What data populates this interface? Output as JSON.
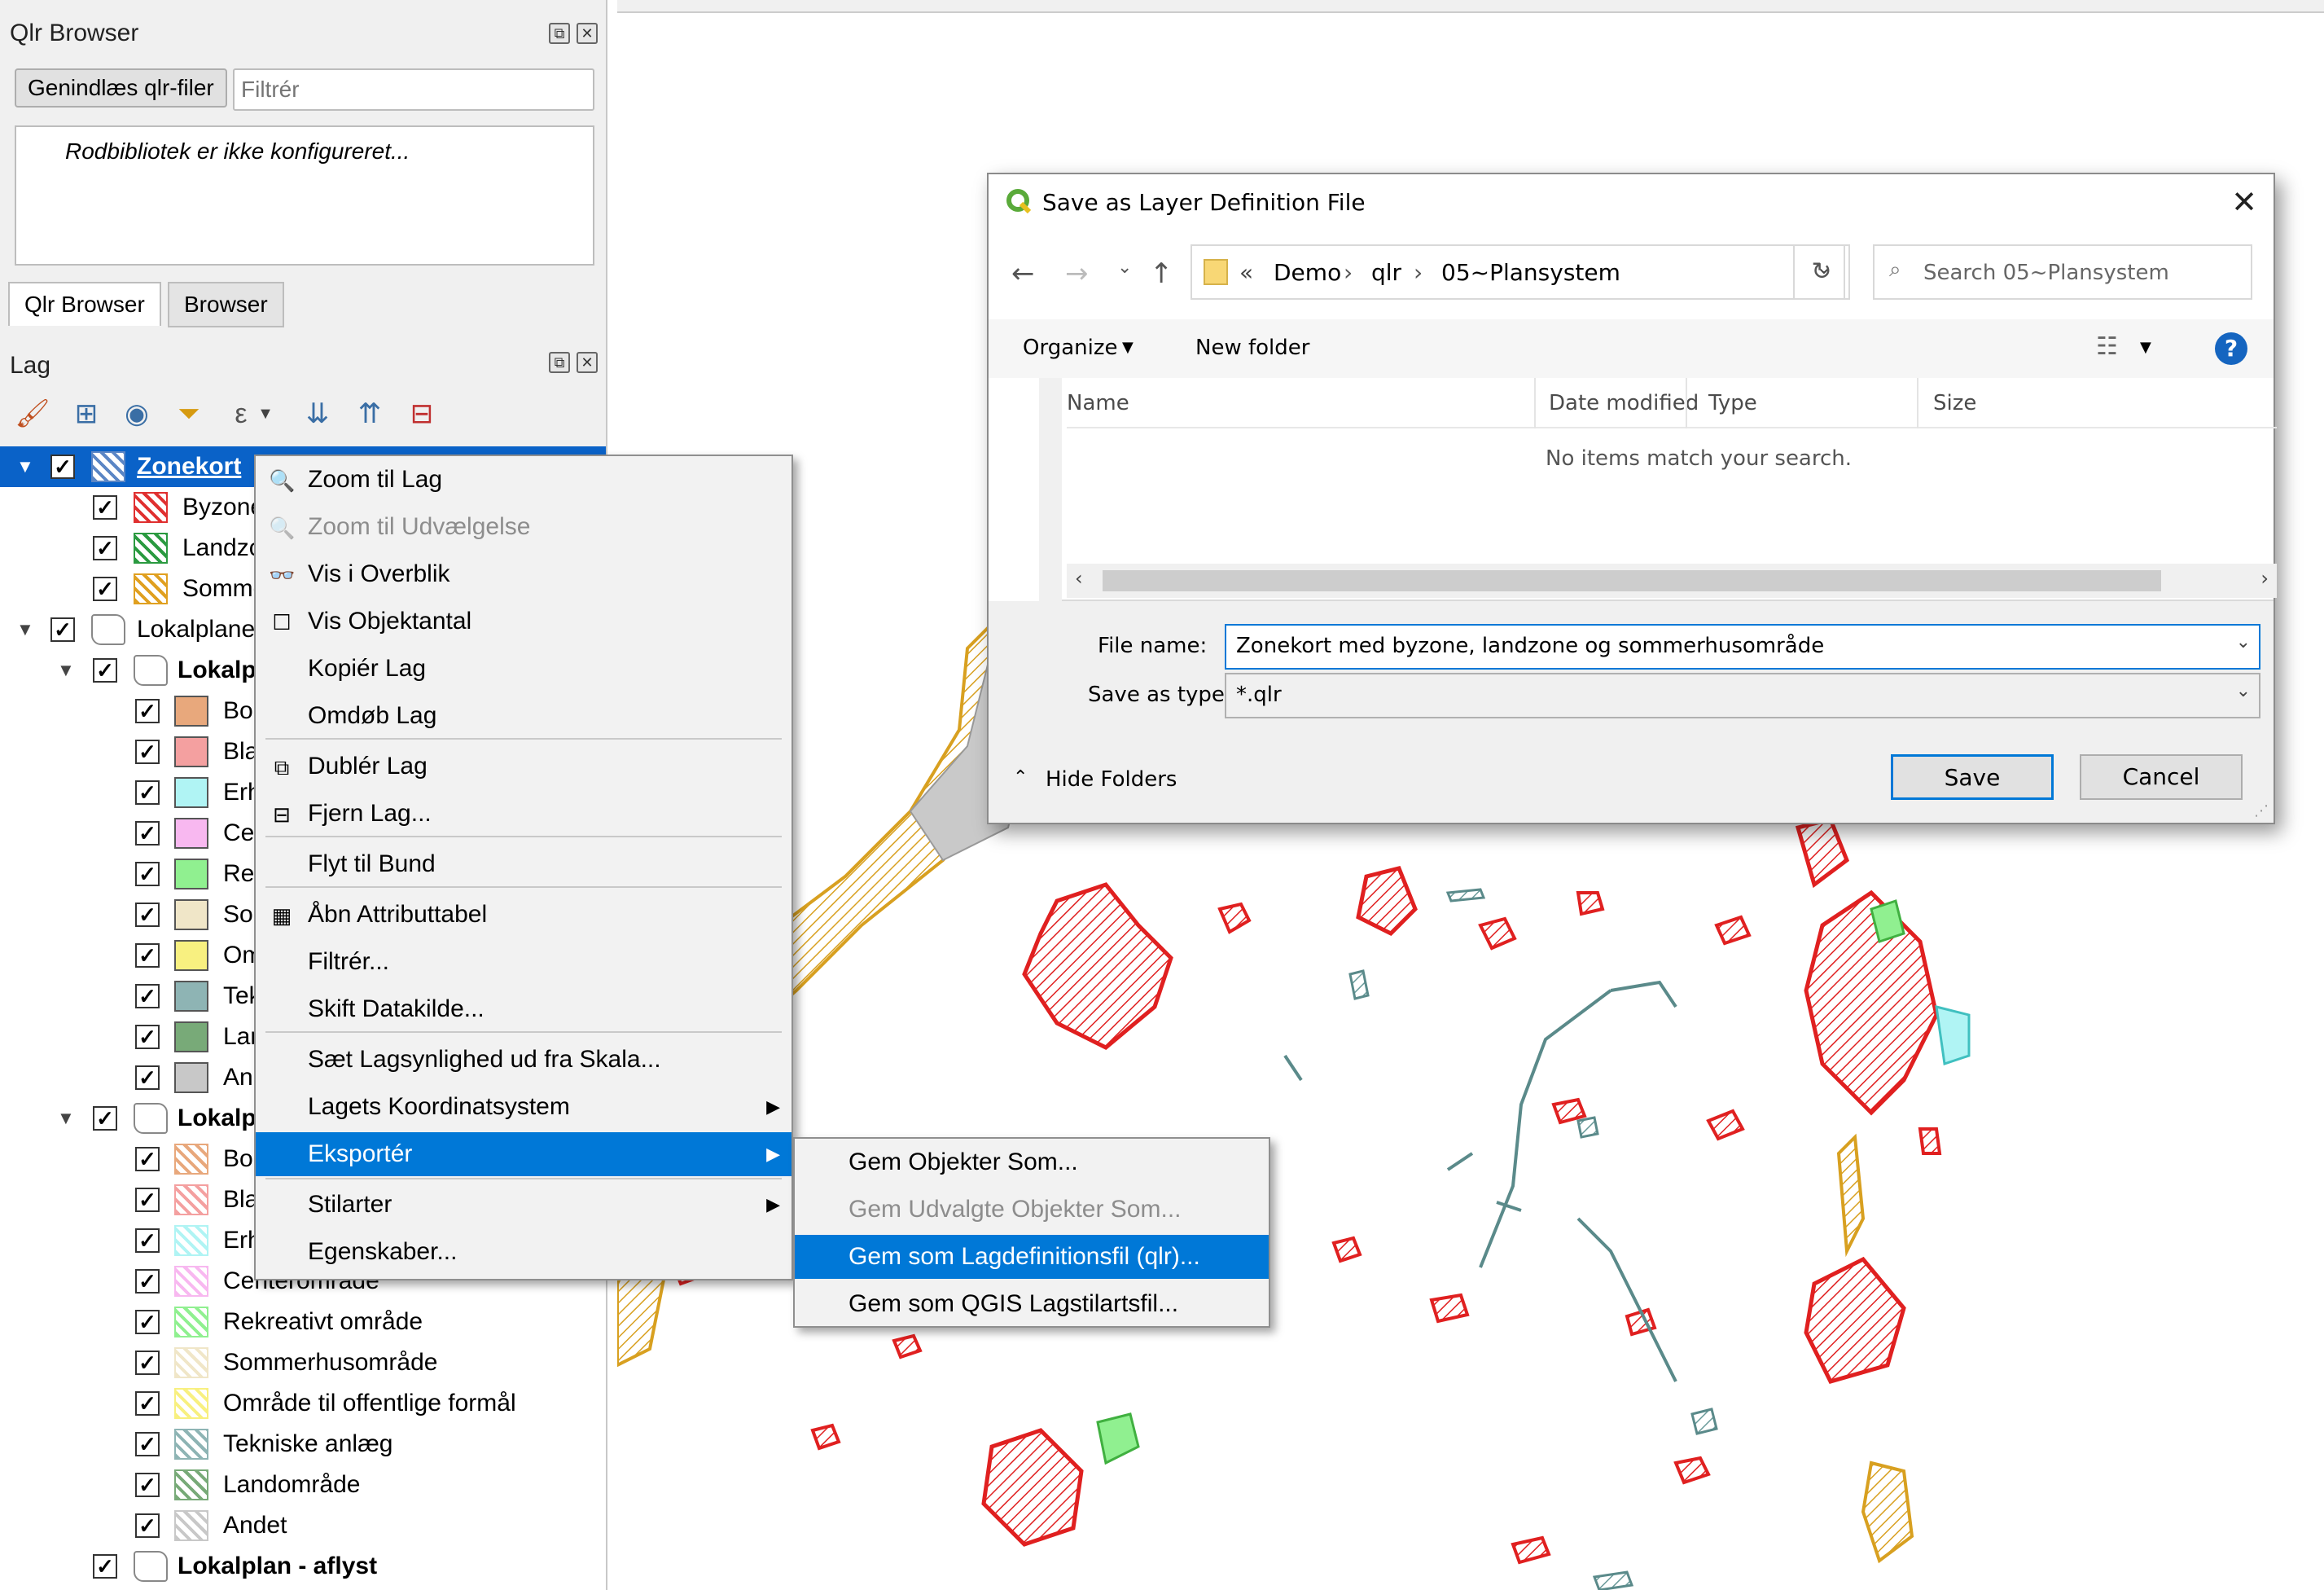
{
  "qlr_panel": {
    "title": "Qlr Browser",
    "reload_button": "Genindlæs qlr-filer",
    "filter_placeholder": "Filtrér",
    "root_message": "Rodbibliotek er ikke konfigureret...",
    "tabs": [
      "Qlr Browser",
      "Browser"
    ]
  },
  "layers_panel": {
    "title": "Lag",
    "tree": [
      {
        "label": "Zonekort",
        "checked": true,
        "expanded": true,
        "selected": true,
        "bold": false,
        "color": "#5b86c5"
      },
      {
        "label": "Byzone",
        "checked": true,
        "color": "#e03030"
      },
      {
        "label": "Landzone",
        "checked": true,
        "color": "#2a9a40"
      },
      {
        "label": "Sommerhusområde",
        "checked": true,
        "color": "#e0a020"
      },
      {
        "label": "Lokalplaner",
        "checked": true,
        "expanded": true
      },
      {
        "label": "Lokalplan - vedtaget",
        "checked": true,
        "expanded": true,
        "bold": true
      },
      {
        "label": "Boligområde",
        "checked": true,
        "color": "#e8a87c"
      },
      {
        "label": "Blandet bolig og erhverv",
        "checked": true,
        "color": "#f4a0a0"
      },
      {
        "label": "Erhvervsområde",
        "checked": true,
        "color": "#b0f4f4"
      },
      {
        "label": "Centerområde",
        "checked": true,
        "color": "#f8b8f0"
      },
      {
        "label": "Rekreativt område",
        "checked": true,
        "color": "#90f090"
      },
      {
        "label": "Sommerhusområde",
        "checked": true,
        "color": "#f0e6c8"
      },
      {
        "label": "Område til offentlige formål",
        "checked": true,
        "color": "#f8f080"
      },
      {
        "label": "Tekniske anlæg",
        "checked": true,
        "color": "#8eb4b4"
      },
      {
        "label": "Landområde",
        "checked": true,
        "color": "#78aa78"
      },
      {
        "label": "Andet",
        "checked": true,
        "color": "#c8c8c8"
      },
      {
        "label": "Lokalplan - forslag",
        "checked": true,
        "expanded": true,
        "bold": true
      },
      {
        "label": "Boligområde",
        "checked": true,
        "color": "#e8a87c"
      },
      {
        "label": "Blandet bolig og erhverv",
        "checked": true,
        "color": "#f4a0a0"
      },
      {
        "label": "Erhvervsområde",
        "checked": true,
        "color": "#b0f4f4"
      },
      {
        "label": "Centerområde",
        "checked": true,
        "color": "#f8b8f0"
      },
      {
        "label": "Rekreativt område",
        "checked": true,
        "color": "#90f090"
      },
      {
        "label": "Sommerhusområde",
        "checked": true,
        "color": "#f0e6c8"
      },
      {
        "label": "Område til offentlige formål",
        "checked": true,
        "color": "#f8f080"
      },
      {
        "label": "Tekniske anlæg",
        "checked": true,
        "color": "#8eb4b4"
      },
      {
        "label": "Landområde",
        "checked": true,
        "color": "#78aa78"
      },
      {
        "label": "Andet",
        "checked": true,
        "color": "#c8c8c8"
      },
      {
        "label": "Lokalplan - aflyst",
        "checked": true,
        "bold": true
      }
    ]
  },
  "context_menu": {
    "items": [
      {
        "label": "Zoom til Lag",
        "icon": "magnifier-icon",
        "glyph": "🔍"
      },
      {
        "label": "Zoom til Udvælgelse",
        "icon": "magnifier-icon",
        "glyph": "🔍",
        "disabled": true
      },
      {
        "label": "Vis i Overblik",
        "icon": "glasses-icon",
        "glyph": "👓"
      },
      {
        "label": "Vis Objektantal",
        "icon": "checkbox-icon",
        "glyph": "☐"
      },
      {
        "label": "Kopiér Lag"
      },
      {
        "label": "Omdøb Lag"
      },
      {
        "label": "Dublér Lag",
        "icon": "duplicate-icon",
        "glyph": "⧉"
      },
      {
        "label": "Fjern Lag...",
        "icon": "remove-layer-icon",
        "glyph": "⊟"
      },
      {
        "label": "Flyt til Bund"
      },
      {
        "label": "Åbn Attributtabel",
        "icon": "table-icon",
        "glyph": "▦"
      },
      {
        "label": "Filtrér..."
      },
      {
        "label": "Skift Datakilde..."
      },
      {
        "label": "Sæt Lagsynlighed ud fra Skala..."
      },
      {
        "label": "Lagets Koordinatsystem",
        "submenu": true
      },
      {
        "label": "Eksportér",
        "submenu": true,
        "active": true
      },
      {
        "label": "Stilarter",
        "submenu": true
      },
      {
        "label": "Egenskaber..."
      }
    ],
    "submenu_arrow": "▶"
  },
  "export_submenu": {
    "items": [
      {
        "label": "Gem Objekter Som..."
      },
      {
        "label": "Gem Udvalgte Objekter Som...",
        "disabled": true
      },
      {
        "label": "Gem som Lagdefinitionsfil (qlr)...",
        "active": true
      },
      {
        "label": "Gem som QGIS Lagstilartsfil..."
      }
    ]
  },
  "save_dialog": {
    "title": "Save as Layer Definition File",
    "close_glyph": "✕",
    "breadcrumb": [
      "«",
      "Demo",
      "qlr",
      "05~Plansystem"
    ],
    "breadcrumb_sep": "›",
    "search_placeholder": "Search 05~Plansystem",
    "toolbar": {
      "organize": "Organize",
      "new_folder": "New folder"
    },
    "help_glyph": "?",
    "columns": [
      "Name",
      "Date modified",
      "Type",
      "Size"
    ],
    "empty_message": "No items match your search.",
    "file_name_label": "File name:",
    "file_name_value": "Zonekort med byzone, landzone og sommerhusområde",
    "save_as_type_label": "Save as type:",
    "save_as_type_value": "*.qlr",
    "hide_folders": "Hide Folders",
    "save_button": "Save",
    "cancel_button": "Cancel"
  },
  "colors": {
    "accent": "#0078d7",
    "selection": "#0a62c8",
    "byzone": "#e03030",
    "landzone": "#2a9a40",
    "sommerhus": "#e0a020"
  }
}
